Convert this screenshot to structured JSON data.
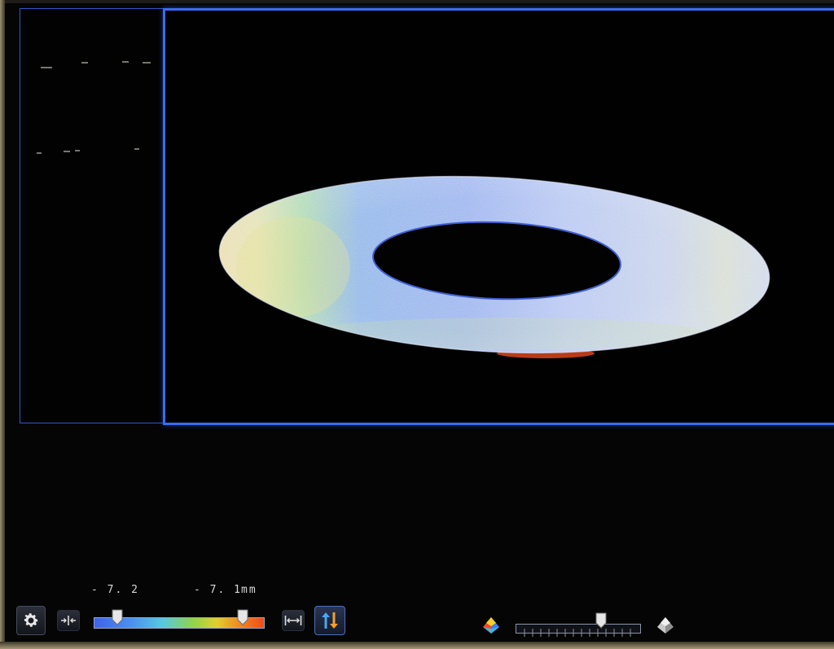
{
  "scale": {
    "min_value": "- 7. 2",
    "max_value": "- 7. 1",
    "unit": "mm",
    "min_handle_position": 0.14,
    "max_handle_position": 0.87
  },
  "shading": {
    "level": 0.68
  },
  "icons": {
    "settings": "gear-icon",
    "fit_in": "compress-horizontal-icon",
    "fit_out": "expand-horizontal-icon",
    "auto_range": "up-down-arrows-icon",
    "color_mode": "color-pyramid-icon",
    "gray_mode": "gray-pyramid-icon"
  },
  "colors": {
    "viewport_border": "#3a6cf0",
    "colormap_low": "#3f63e8",
    "colormap_high": "#ef4a1c"
  }
}
